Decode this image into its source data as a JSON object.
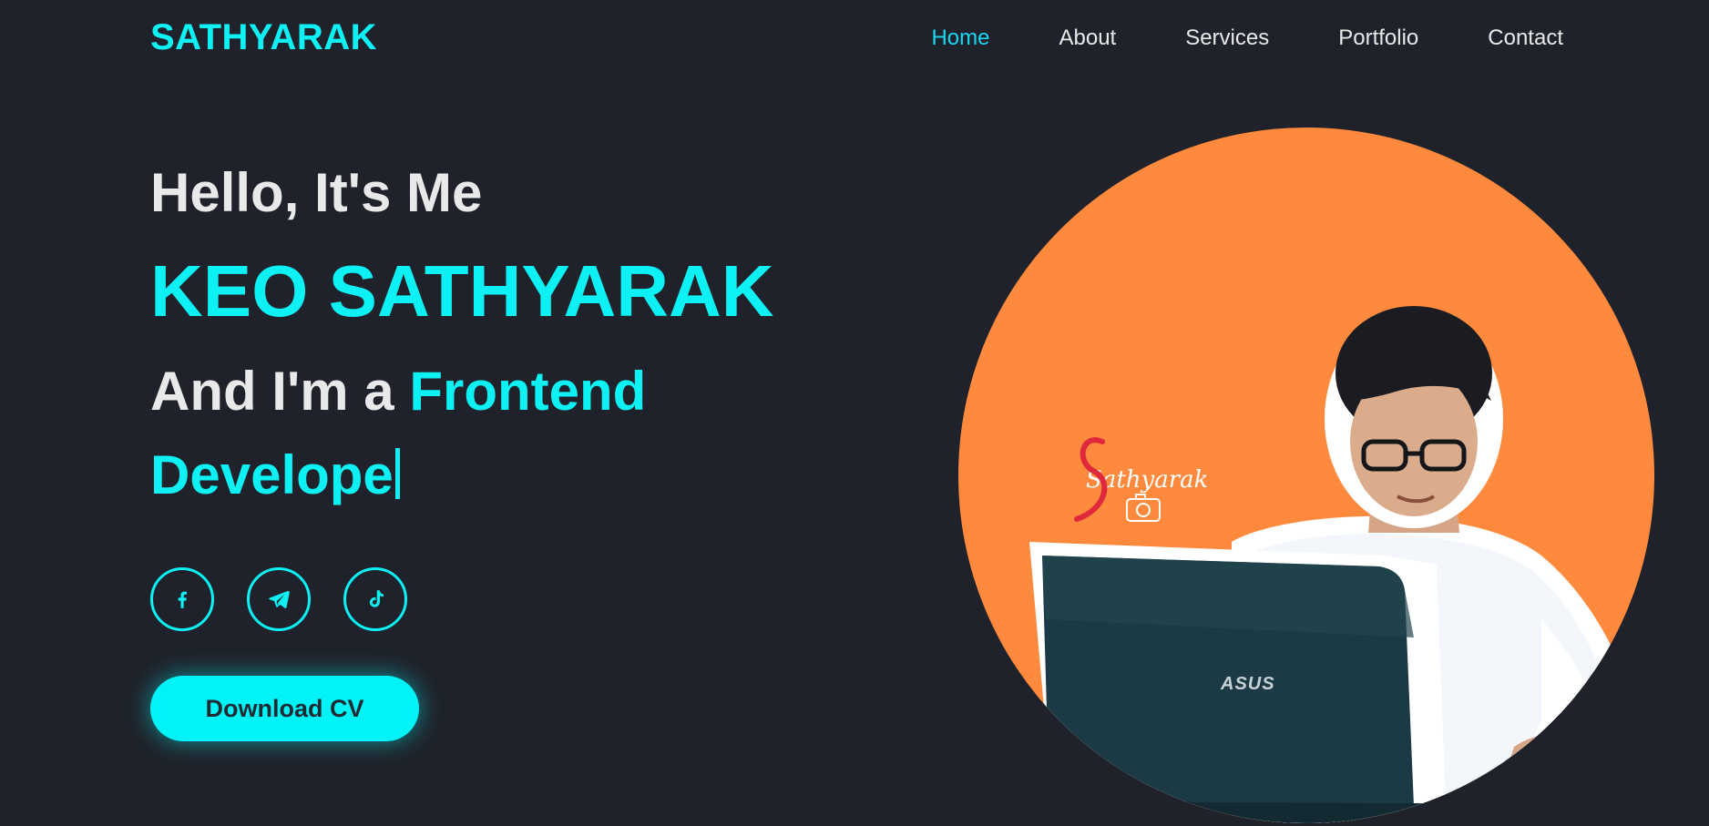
{
  "brand": {
    "logo": "SATHYARAK"
  },
  "nav": {
    "items": [
      {
        "label": "Home",
        "active": true
      },
      {
        "label": "About"
      },
      {
        "label": "Services"
      },
      {
        "label": "Portfolio"
      },
      {
        "label": "Contact"
      }
    ]
  },
  "hero": {
    "greeting": "Hello, It's Me",
    "name": "KEO SATHYARAK",
    "role_prefix": "And I'm a",
    "role_typed": "Frontend Develope",
    "cv_button": "Download CV"
  },
  "social": [
    {
      "icon": "facebook-icon"
    },
    {
      "icon": "telegram-icon"
    },
    {
      "icon": "tiktok-icon"
    }
  ],
  "portrait": {
    "signature": "Sathyarak",
    "laptop_brand": "ASUS"
  },
  "colors": {
    "background": "#1f222a",
    "accent": "#0ef1f4",
    "text": "#e9e9ea",
    "portrait_circle": "#ff8a3d"
  }
}
